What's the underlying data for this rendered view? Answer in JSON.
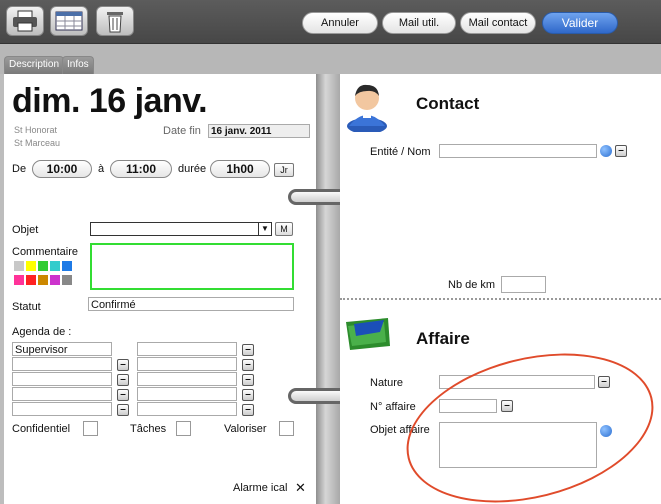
{
  "toolbar": {
    "icons": [
      "printer-icon",
      "calendar-grid-icon",
      "trash-icon"
    ],
    "annuler": "Annuler",
    "mail_util": "Mail util.",
    "mail_contact": "Mail contact",
    "valider": "Valider"
  },
  "tabs": [
    {
      "label": "Description"
    },
    {
      "label": "Infos"
    }
  ],
  "left": {
    "date_title": "dim. 16 janv.",
    "saint1": "St Honorat",
    "saint2": "St Marceau",
    "date_fin_label": "Date  fin",
    "date_fin_value": "16 janv. 2011",
    "de_label": "De",
    "start_time": "10:00",
    "a_label": "à",
    "end_time": "11:00",
    "duree_label": "durée",
    "duration": "1h00",
    "jr_button": "Jr",
    "objet_label": "Objet",
    "objet_value": "",
    "m_button": "M",
    "commentaire_label": "Commentaire",
    "statut_label": "Statut",
    "statut_value": "Confirmé",
    "agenda_label": "Agenda de :",
    "agenda_first": "Supervisor",
    "confidentiel_label": "Confidentiel",
    "taches_label": "Tâches",
    "valoriser_label": "Valoriser",
    "alarme_label": "Alarme ical",
    "alarme_mark": "✕",
    "swatch_colors": [
      "#c8c8c8",
      "#ffff00",
      "#33cc33",
      "#33cccc",
      "#1e7ae6",
      "#ff3399",
      "#ff2222",
      "#cc8800",
      "#cc33cc",
      "#888888"
    ]
  },
  "right": {
    "contact_title": "Contact",
    "entite_label": "Entité / Nom",
    "nb_km_label": "Nb de km",
    "affaire_title": "Affaire",
    "nature_label": "Nature",
    "num_affaire_label": "N° affaire",
    "objet_affaire_label": "Objet affaire"
  },
  "colors": {
    "annotation": "#e04b2b",
    "commentaire_border": "#33dd33",
    "valider": "#2f68c9"
  }
}
